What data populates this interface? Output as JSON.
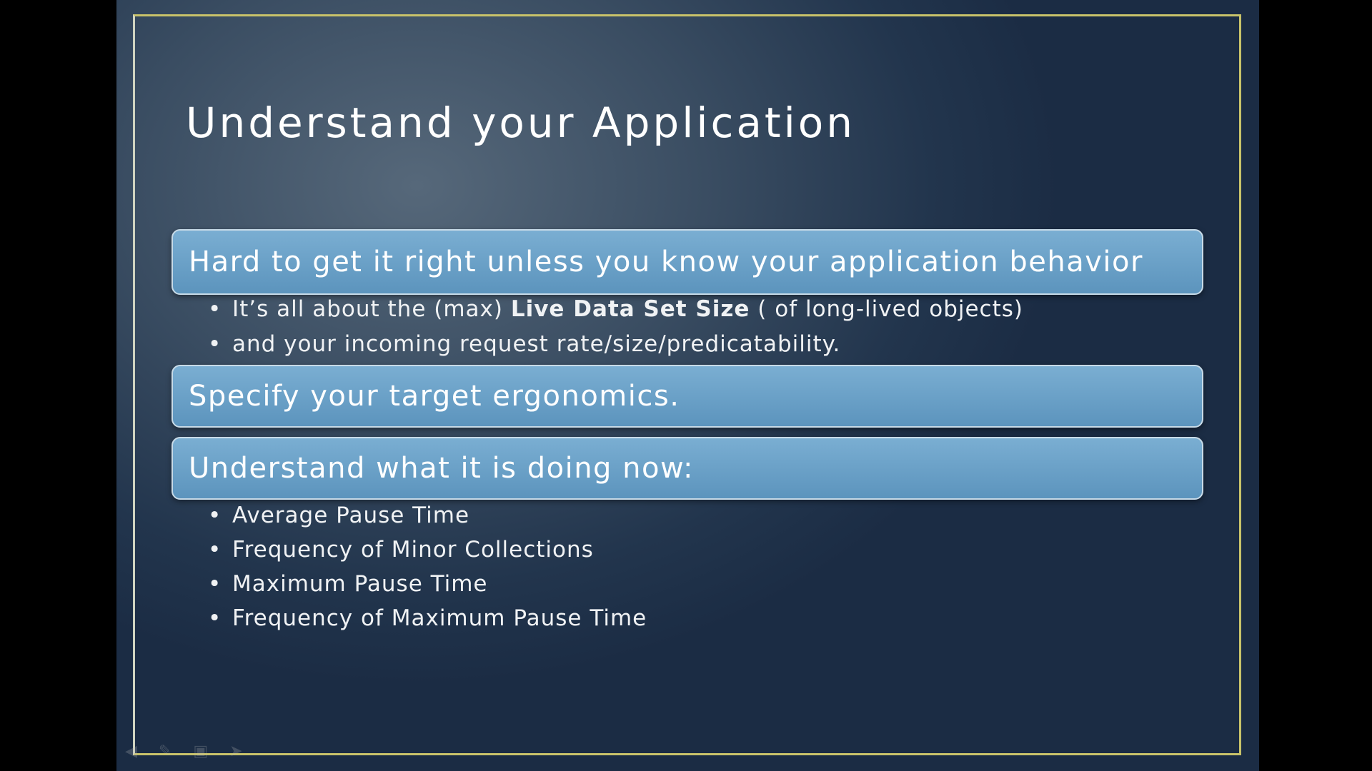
{
  "title": "Understand your Application",
  "boxes": [
    {
      "text": "Hard to get it right unless you know your application behavior"
    },
    {
      "text": "Specify your target ergonomics."
    },
    {
      "text": "Understand what it is doing now:"
    }
  ],
  "bullets1": [
    {
      "pre": "It’s all about the (max) ",
      "bold": "Live Data Set Size",
      "post": " ( of long-lived objects)"
    },
    {
      "pre": "and your incoming request rate/size/predicatability."
    }
  ],
  "bullets3": [
    "Average Pause Time",
    "Frequency of Minor Collections",
    "Maximum Pause Time",
    "Frequency of Maximum Pause Time"
  ],
  "bullet_glyph": "•",
  "colors": {
    "frame": "#c9c36a",
    "box": "#6aa2c9",
    "background": "#2c3f56"
  }
}
